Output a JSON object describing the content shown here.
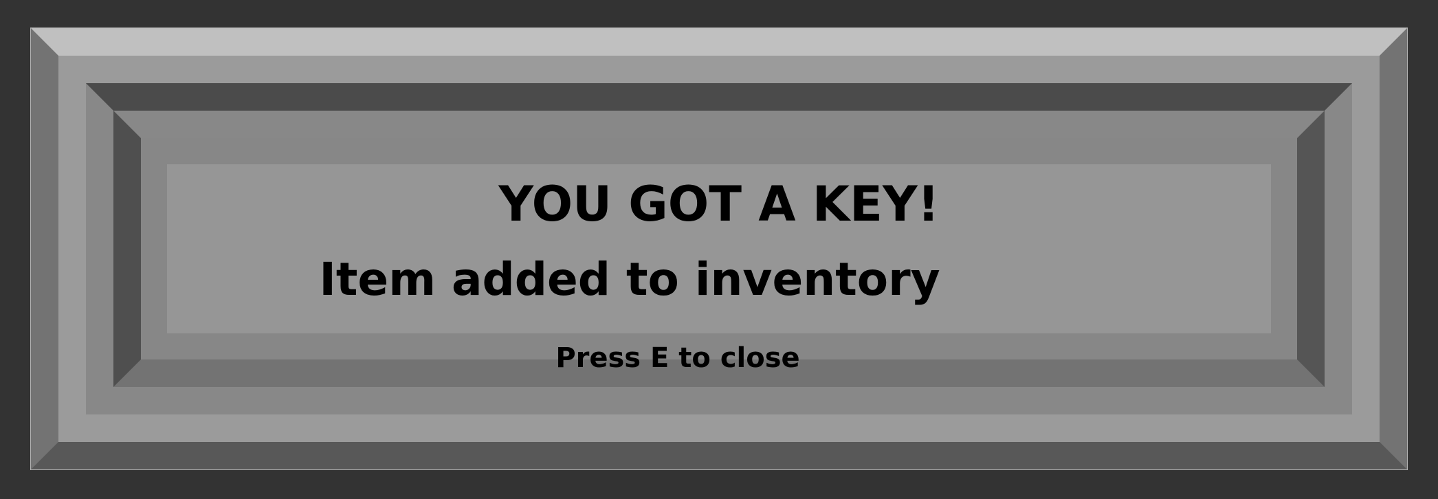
{
  "popup": {
    "title": "YOU GOT A KEY!",
    "message": "Item added to inventory",
    "hint": "Press E to close"
  },
  "colors": {
    "background": "#333333",
    "panel": "#969696",
    "text": "#000000"
  }
}
